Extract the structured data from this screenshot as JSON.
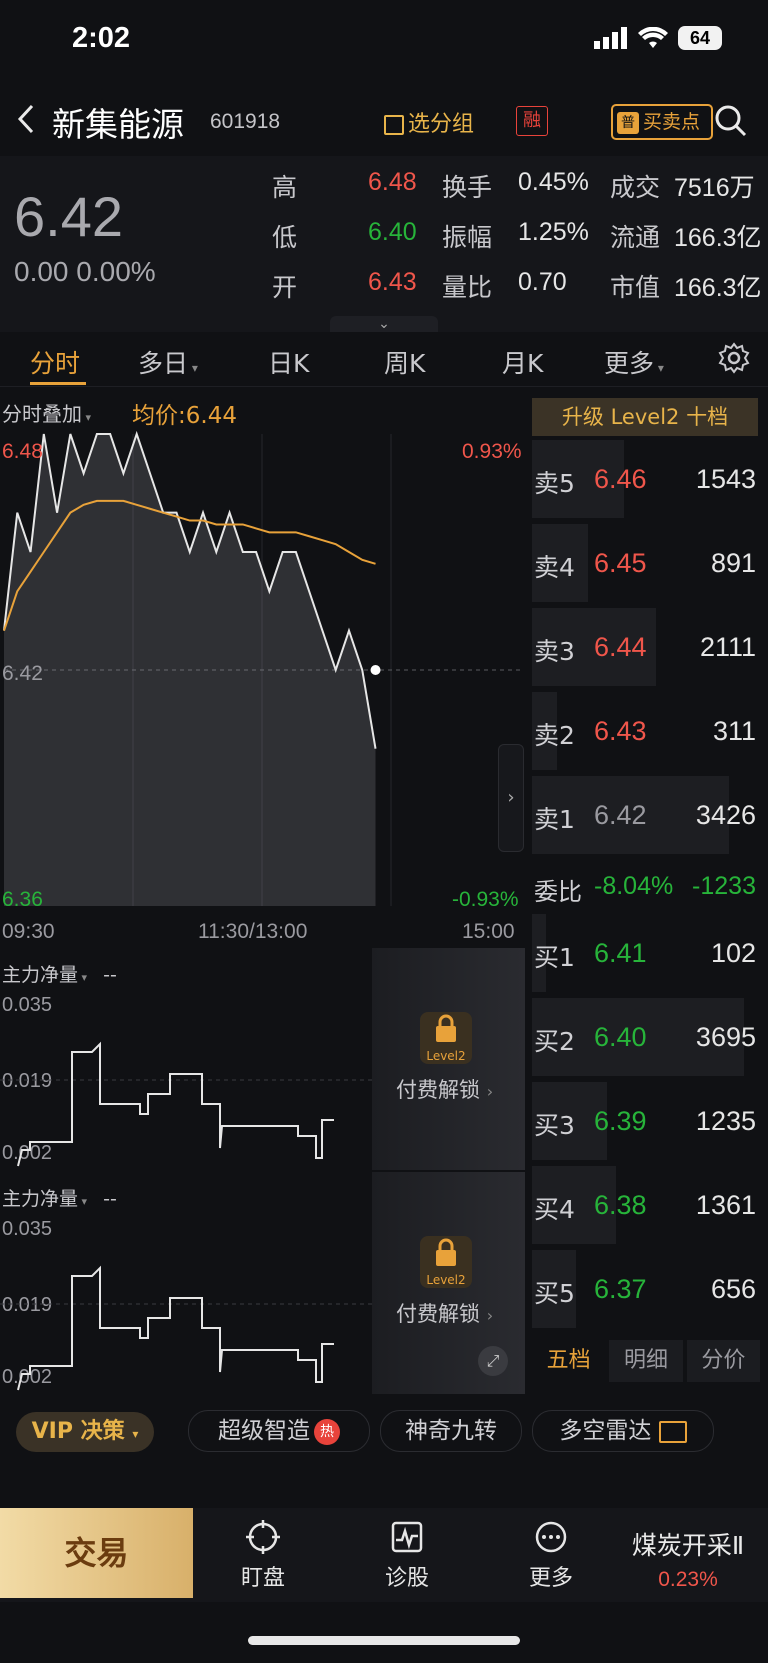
{
  "status_bar": {
    "time": "2:02",
    "battery": "64"
  },
  "header": {
    "stock_name": "新集能源",
    "stock_code": "601918",
    "group_label": "选分组",
    "margin_badge": "融",
    "buy_sell_badge": "普",
    "buy_sell_label": "买卖点"
  },
  "quote": {
    "price": "6.42",
    "change": "0.00",
    "change_pct": "0.00%",
    "stats": [
      {
        "label": "高",
        "value": "6.48",
        "color": "red"
      },
      {
        "label": "换手",
        "value": "0.45%"
      },
      {
        "label": "成交",
        "value": "7516万"
      },
      {
        "label": "低",
        "value": "6.40",
        "color": "green"
      },
      {
        "label": "振幅",
        "value": "1.25%"
      },
      {
        "label": "流通",
        "value": "166.3亿"
      },
      {
        "label": "开",
        "value": "6.43",
        "color": "red"
      },
      {
        "label": "量比",
        "value": "0.70"
      },
      {
        "label": "市值",
        "value": "166.3亿"
      }
    ]
  },
  "tabs": [
    "分时",
    "多日",
    "日K",
    "周K",
    "月K",
    "更多"
  ],
  "active_tab": "分时",
  "intraday": {
    "overlay_label": "分时叠加",
    "avg_label": "均价:6.44",
    "top_price": "6.48",
    "top_pct": "0.93%",
    "mid_price": "6.42",
    "bottom_price": "6.36",
    "bottom_pct": "-0.93%",
    "time_labels": [
      "09:30",
      "11:30/13:00",
      "15:00"
    ],
    "chart_data": {
      "type": "line",
      "title": "",
      "ylim": [
        6.36,
        6.48
      ],
      "series": [
        {
          "name": "price",
          "values": [
            6.43,
            6.46,
            6.45,
            6.48,
            6.46,
            6.48,
            6.47,
            6.48,
            6.48,
            6.47,
            6.48,
            6.47,
            6.46,
            6.46,
            6.45,
            6.46,
            6.45,
            6.46,
            6.45,
            6.45,
            6.44,
            6.45,
            6.45,
            6.44,
            6.43,
            6.42,
            6.43,
            6.42,
            6.4
          ]
        },
        {
          "name": "均价",
          "values": [
            6.43,
            6.44,
            6.445,
            6.45,
            6.455,
            6.46,
            6.462,
            6.463,
            6.463,
            6.463,
            6.462,
            6.461,
            6.46,
            6.459,
            6.458,
            6.458,
            6.457,
            6.457,
            6.457,
            6.456,
            6.455,
            6.455,
            6.455,
            6.454,
            6.453,
            6.452,
            6.45,
            6.448,
            6.447
          ]
        }
      ]
    }
  },
  "order_book": {
    "upgrade_label": "升级 Level2 十档",
    "asks": [
      {
        "label": "卖5",
        "price": "6.46",
        "vol": "1543",
        "fill": 0.4
      },
      {
        "label": "卖4",
        "price": "6.45",
        "vol": "891",
        "fill": 0.23
      },
      {
        "label": "卖3",
        "price": "6.44",
        "vol": "2111",
        "fill": 0.55
      },
      {
        "label": "卖2",
        "price": "6.43",
        "vol": "311",
        "fill": 0.08
      },
      {
        "label": "卖1",
        "price": "6.42",
        "vol": "3426",
        "fill": 0.9
      }
    ],
    "ratio_label": "委比",
    "ratio_pct": "-8.04%",
    "ratio_val": "-1233",
    "bids": [
      {
        "label": "买1",
        "price": "6.41",
        "vol": "102",
        "fill": 0.03
      },
      {
        "label": "买2",
        "price": "6.40",
        "vol": "3695",
        "fill": 0.97
      },
      {
        "label": "买3",
        "price": "6.39",
        "vol": "1235",
        "fill": 0.32
      },
      {
        "label": "买4",
        "price": "6.38",
        "vol": "1361",
        "fill": 0.36
      },
      {
        "label": "买5",
        "price": "6.37",
        "vol": "656",
        "fill": 0.17
      }
    ],
    "tabs": [
      "五档",
      "明细",
      "分价"
    ]
  },
  "indicators": [
    {
      "label": "主力净量",
      "value": "--",
      "ticks": [
        "0.035",
        "0.019",
        "0.002"
      ],
      "lock_text": "Level2",
      "unlock_label": "付费解锁"
    },
    {
      "label": "主力净量",
      "value": "--",
      "ticks": [
        "0.035",
        "0.019",
        "0.002"
      ],
      "lock_text": "Level2",
      "unlock_label": "付费解锁"
    }
  ],
  "decision_bar": {
    "vip": "VIP 决策",
    "items": [
      "超级智造",
      "神奇九转",
      "多空雷达"
    ],
    "hot": "热"
  },
  "bottom_nav": {
    "trade": "交易",
    "items": [
      "盯盘",
      "诊股",
      "更多"
    ],
    "sector_name": "煤炭开采Ⅱ",
    "sector_pct": "0.23%"
  }
}
